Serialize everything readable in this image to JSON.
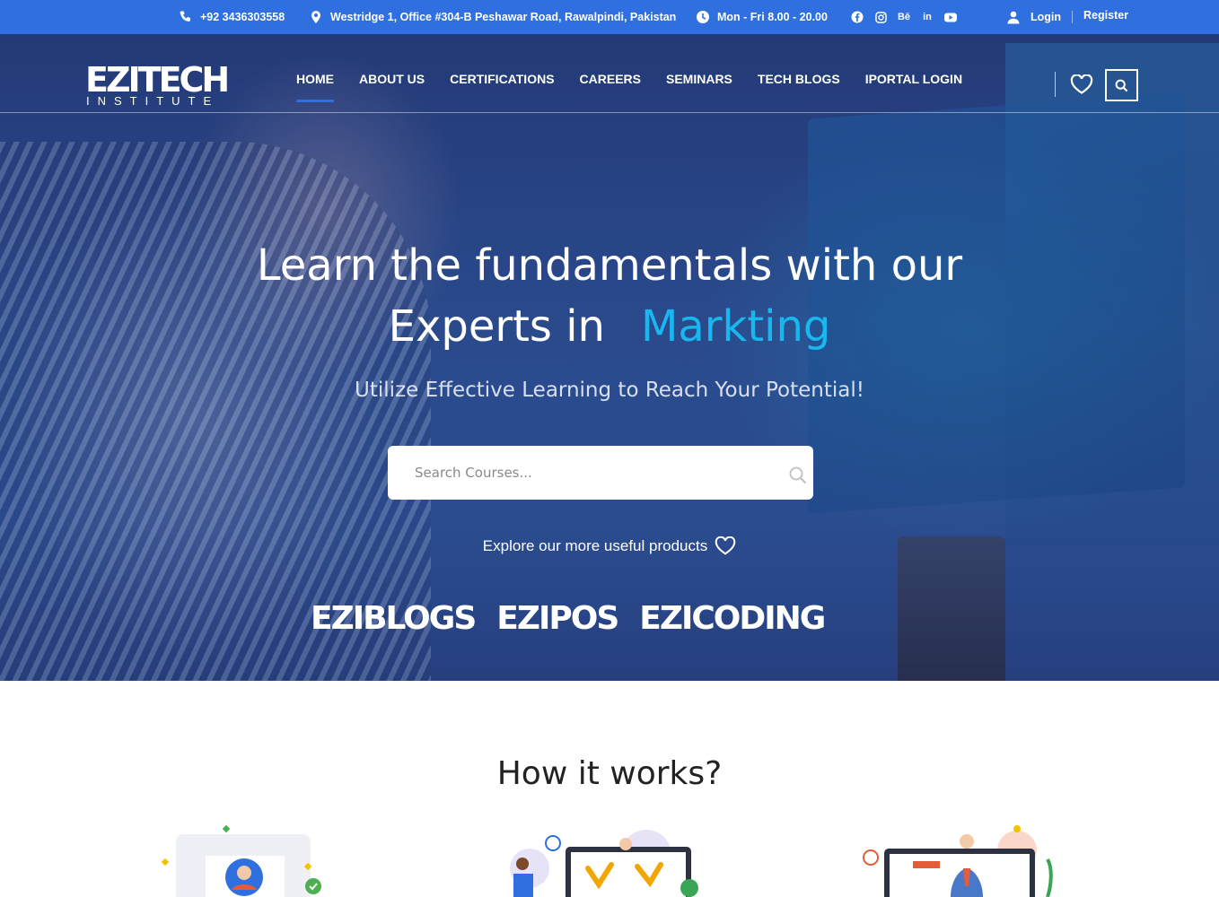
{
  "topbar": {
    "phone": "+92 3436303558",
    "address": "Westridge 1, Office #304-B Peshawar Road, Rawalpindi, Pakistan",
    "hours": "Mon - Fri 8.00 - 20.00",
    "social": [
      "facebook-icon",
      "instagram-icon",
      "behance-icon",
      "linkedin-icon",
      "youtube-icon"
    ],
    "behance_text": "Bē",
    "linkedin_text": "in",
    "login": "Login",
    "register": "Register"
  },
  "nav": {
    "logo_main": "EZITECH",
    "logo_sub": "INSTITUTE",
    "items": [
      "HOME",
      "ABOUT US",
      "CERTIFICATIONS",
      "CAREERS",
      "SEMINARS",
      "TECH BLOGS",
      "IPORTAL LOGIN"
    ],
    "active": "HOME"
  },
  "hero": {
    "headline_line1": "Learn the fundamentals with our",
    "headline_line2": "Experts in",
    "headline_accent": "Markting",
    "subheadline": "Utilize Effective Learning to Reach Your Potential!",
    "search_placeholder": "Search Courses...",
    "explore_text": "Explore our more useful products",
    "products": [
      "EZIBLOGS",
      "EZIPOS",
      "EZICODING"
    ]
  },
  "how": {
    "title": "How it works?"
  },
  "colors": {
    "topbar": "#2f6fe0",
    "accent": "#19b7f0",
    "active_underline": "#2f6fe0"
  }
}
